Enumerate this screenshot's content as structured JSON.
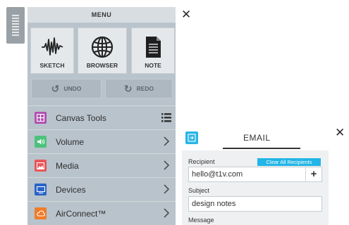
{
  "menu": {
    "title": "MENU",
    "tiles": [
      {
        "label": "SKETCH",
        "icon": "sketch-waveform-icon"
      },
      {
        "label": "BROWSER",
        "icon": "globe-icon"
      },
      {
        "label": "NOTE",
        "icon": "note-document-icon"
      }
    ],
    "undo_label": "UNDO",
    "redo_label": "REDO",
    "items": [
      {
        "label": "Canvas Tools",
        "icon": "canvas-tools-icon",
        "icon_color": "#b051b1",
        "trailing": "list"
      },
      {
        "label": "Volume",
        "icon": "speaker-icon",
        "icon_color": "#4dc27b",
        "trailing": "chevron"
      },
      {
        "label": "Media",
        "icon": "image-icon",
        "icon_color": "#e8555a",
        "trailing": "chevron"
      },
      {
        "label": "Devices",
        "icon": "monitor-icon",
        "icon_color": "#2b63c7",
        "trailing": "chevron"
      },
      {
        "label": "AirConnect™",
        "icon": "cloud-icon",
        "icon_color": "#f07c2a",
        "trailing": "chevron"
      }
    ]
  },
  "email": {
    "title": "EMAIL",
    "recipient_label": "Recipient",
    "clear_label": "Clear All Recipients",
    "recipient_value": "hello@t1v.com",
    "subject_label": "Subject",
    "subject_value": "design notes",
    "message_label": "Message"
  },
  "colors": {
    "accent": "#22b5e6",
    "menu_bg": "#b9c3cb",
    "header_bg": "#d8dde1"
  }
}
